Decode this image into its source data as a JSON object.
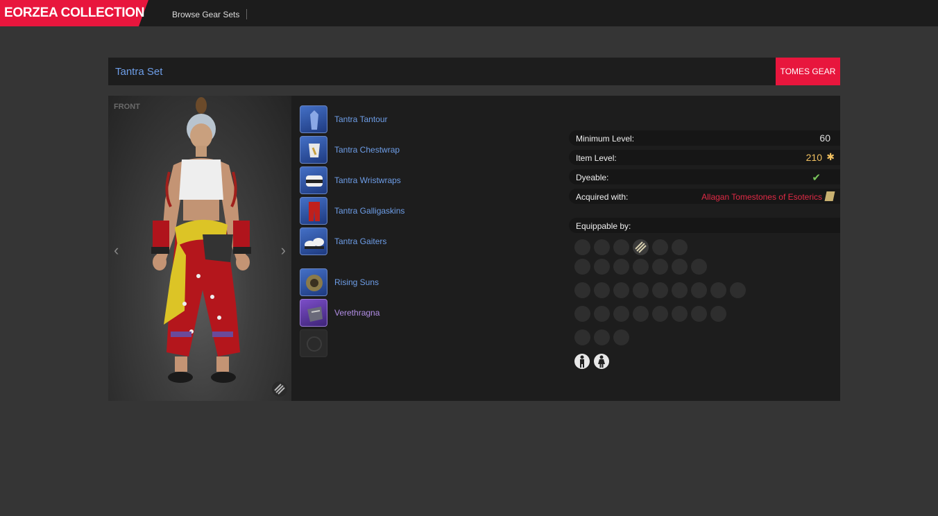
{
  "nav": {
    "logo": "EORZEA COLLECTION",
    "browse_label": "Browse Gear Sets"
  },
  "set": {
    "title": "Tantra Set",
    "tag": "TOMES GEAR",
    "view_label": "FRONT"
  },
  "items": [
    {
      "name": "Tantra Tantour",
      "icon": "head-gear-icon",
      "rarity": "blue"
    },
    {
      "name": "Tantra Chestwrap",
      "icon": "body-gear-icon",
      "rarity": "blue"
    },
    {
      "name": "Tantra Wristwraps",
      "icon": "hands-gear-icon",
      "rarity": "blue"
    },
    {
      "name": "Tantra Galligaskins",
      "icon": "legs-gear-icon",
      "rarity": "blue"
    },
    {
      "name": "Tantra Gaiters",
      "icon": "feet-gear-icon",
      "rarity": "blue"
    },
    {
      "name": "Rising Suns",
      "icon": "weapon-icon",
      "rarity": "blue"
    },
    {
      "name": "Verethragna",
      "icon": "weapon-icon",
      "rarity": "purple"
    }
  ],
  "stats": {
    "min_level_label": "Minimum Level:",
    "min_level": "60",
    "item_level_label": "Item Level:",
    "item_level": "210",
    "dyeable_label": "Dyeable:",
    "dyeable_mark": "✔",
    "acquired_label": "Acquired with:",
    "acquired_value": "Allagan Tomestones of Esoterics",
    "equippable_label": "Equippable by:"
  },
  "colors": {
    "accent": "#e8163d",
    "link": "#6e9ee8",
    "gold": "#f0c060",
    "red": "#e22a46",
    "check": "#79c45a"
  }
}
